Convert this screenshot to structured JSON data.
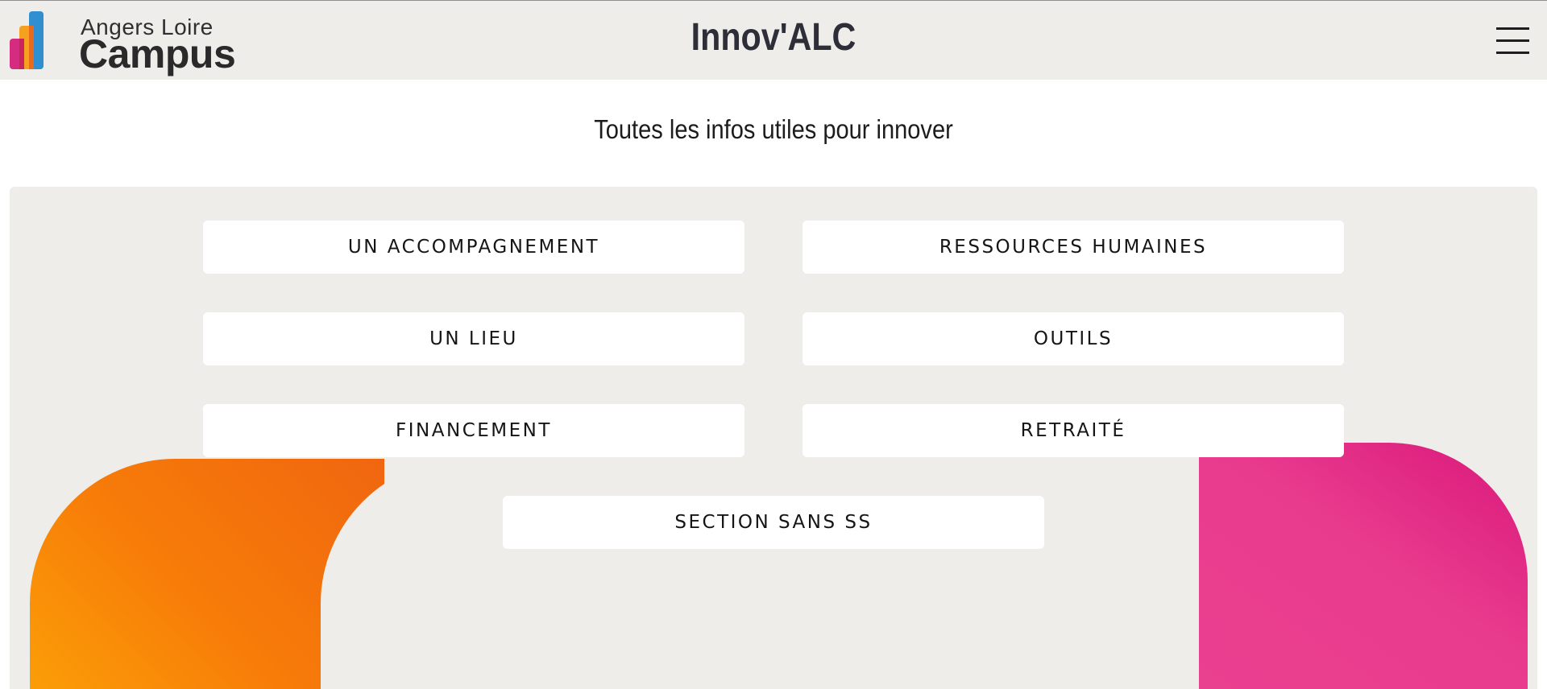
{
  "header": {
    "logo": {
      "line1": "Angers Loire",
      "line2": "Campus",
      "icon_name": "bar-chart-logo-icon",
      "colors": [
        "#d62c80",
        "#f5a020",
        "#2f8fd0"
      ]
    },
    "title": "Innov'ALC",
    "menu_icon": "hamburger-menu-icon"
  },
  "main": {
    "subtitle": "Toutes les infos utiles pour innover",
    "buttons": [
      {
        "label": "UN ACCOMPAGNEMENT"
      },
      {
        "label": "RESSOURCES HUMAINES"
      },
      {
        "label": "UN LIEU"
      },
      {
        "label": "OUTILS"
      },
      {
        "label": "FINANCEMENT"
      },
      {
        "label": "RETRAITÉ"
      },
      {
        "label": "SECTION SANS SS"
      }
    ]
  },
  "colors": {
    "header_bg": "#eeedea",
    "panel_bg": "#eeedea",
    "orange": "#f77c08",
    "pink": "#ea4090",
    "blue": "#33b5d6",
    "title_text": "#2e2e38"
  }
}
